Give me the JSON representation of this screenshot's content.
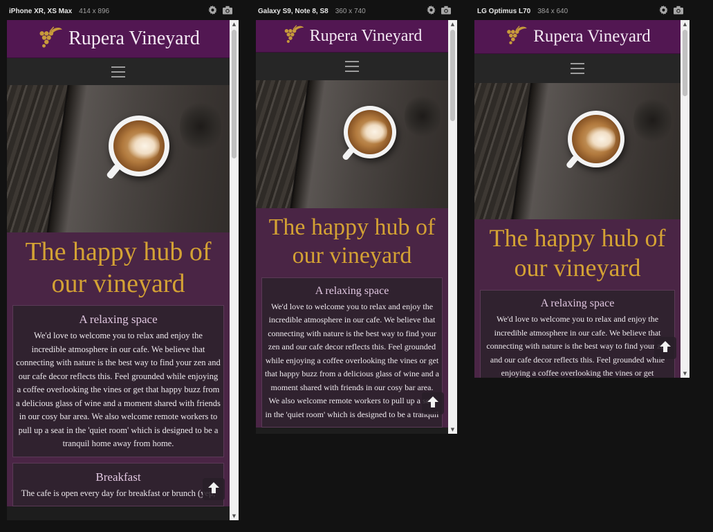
{
  "devices": [
    {
      "name": "iPhone XR, XS Max",
      "size": "414 x 896",
      "site": {
        "title": "Rupera Vineyard",
        "headline": "The happy hub of our vineyard",
        "cards": [
          {
            "title": "A relaxing space",
            "body": "We'd love to welcome you to relax and enjoy the incredible atmosphere in our cafe. We believe that connecting with nature is the best way to find your zen and our cafe decor reflects this. Feel grounded while enjoying a coffee overlooking the vines or get that happy buzz from a delicious glass of wine and a moment shared with friends in our cosy bar area. We also welcome remote workers to pull up a seat in the 'quiet room' which is designed to be a tranquil home away from home."
          },
          {
            "title": "Breakfast",
            "body": "The cafe is open every day for breakfast or brunch (yep,"
          }
        ]
      }
    },
    {
      "name": "Galaxy S9, Note 8, S8",
      "size": "360 x 740",
      "site": {
        "title": "Rupera Vineyard",
        "headline": "The happy hub of our vineyard",
        "cards": [
          {
            "title": "A relaxing space",
            "body": "We'd love to welcome you to relax and enjoy the incredible atmosphere in our cafe. We believe that connecting with nature is the best way to find your zen and our cafe decor reflects this. Feel grounded while enjoying a coffee overlooking the vines or get that happy buzz from a delicious glass of wine and a moment shared with friends in our cosy bar area. We also welcome remote workers to pull up a seat in the 'quiet room' which is designed to be a tranquil"
          }
        ]
      }
    },
    {
      "name": "LG Optimus L70",
      "size": "384 x 640",
      "site": {
        "title": "Rupera Vineyard",
        "headline": "The happy hub of our vineyard",
        "cards": [
          {
            "title": "A relaxing space",
            "body": "We'd love to welcome you to relax and enjoy the incredible atmosphere in our cafe. We believe that connecting with nature is the best way to find your zen and our cafe decor reflects this. Feel grounded while enjoying a coffee overlooking the vines or get"
          }
        ]
      }
    }
  ],
  "icons": {
    "settings": "gear-icon",
    "screenshot": "camera-icon",
    "menu": "hamburger-menu-icon",
    "logo": "grapes-logo-icon",
    "back_to_top": "arrow-up-icon"
  },
  "colors": {
    "background": "#121212",
    "header": "#521752",
    "nav": "#262626",
    "content": "#4a2545",
    "card": "#30222f",
    "headline": "#d4a234",
    "card_title": "#e0c6e0",
    "logo": "#c79a3b"
  }
}
